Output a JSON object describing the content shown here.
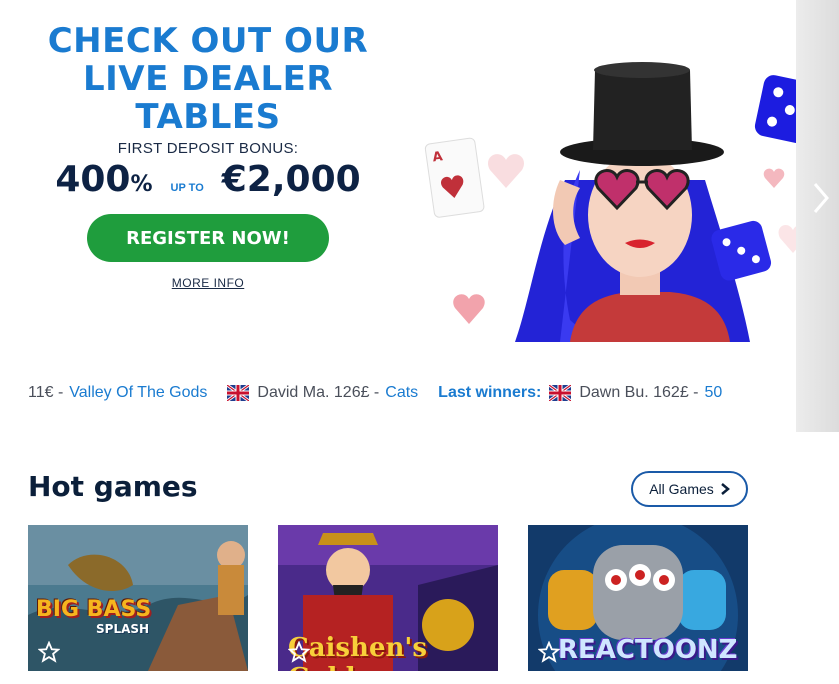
{
  "hero": {
    "title_lines": [
      "CHECK OUT OUR",
      "LIVE DEALER",
      "TABLES"
    ],
    "bonus_label": "FIRST DEPOSIT BONUS:",
    "bonus_percent": "400",
    "bonus_percent_sign": "%",
    "bonus_up_to": "UP TO",
    "bonus_amount": "€2,000",
    "register_label": "REGISTER NOW!",
    "more_info_label": "MORE INFO"
  },
  "ticker": {
    "items": [
      {
        "prefix": "11€ -",
        "game": "Valley Of The Gods"
      },
      {
        "player": "David Ma. 126£ -",
        "game": "Cats"
      }
    ],
    "last_winners_label": "Last winners:",
    "trailing": {
      "player": "Dawn Bu. 162£ -",
      "game": "50"
    }
  },
  "hot_games": {
    "title": "Hot games",
    "all_games_label": "All Games",
    "games": [
      {
        "logo_line1": "BIG BASS",
        "logo_line2": "SPLASH"
      },
      {
        "logo": "Caishen's Gold"
      },
      {
        "logo": "REACTOONZ"
      }
    ]
  },
  "colors": {
    "accent_blue": "#1a7bd0",
    "register_green": "#1f9d3d",
    "navy": "#0b1f3a"
  },
  "icons": {
    "next": "chevron-right-icon",
    "favorite": "star-outline-icon",
    "flag": "uk-flag-icon"
  }
}
